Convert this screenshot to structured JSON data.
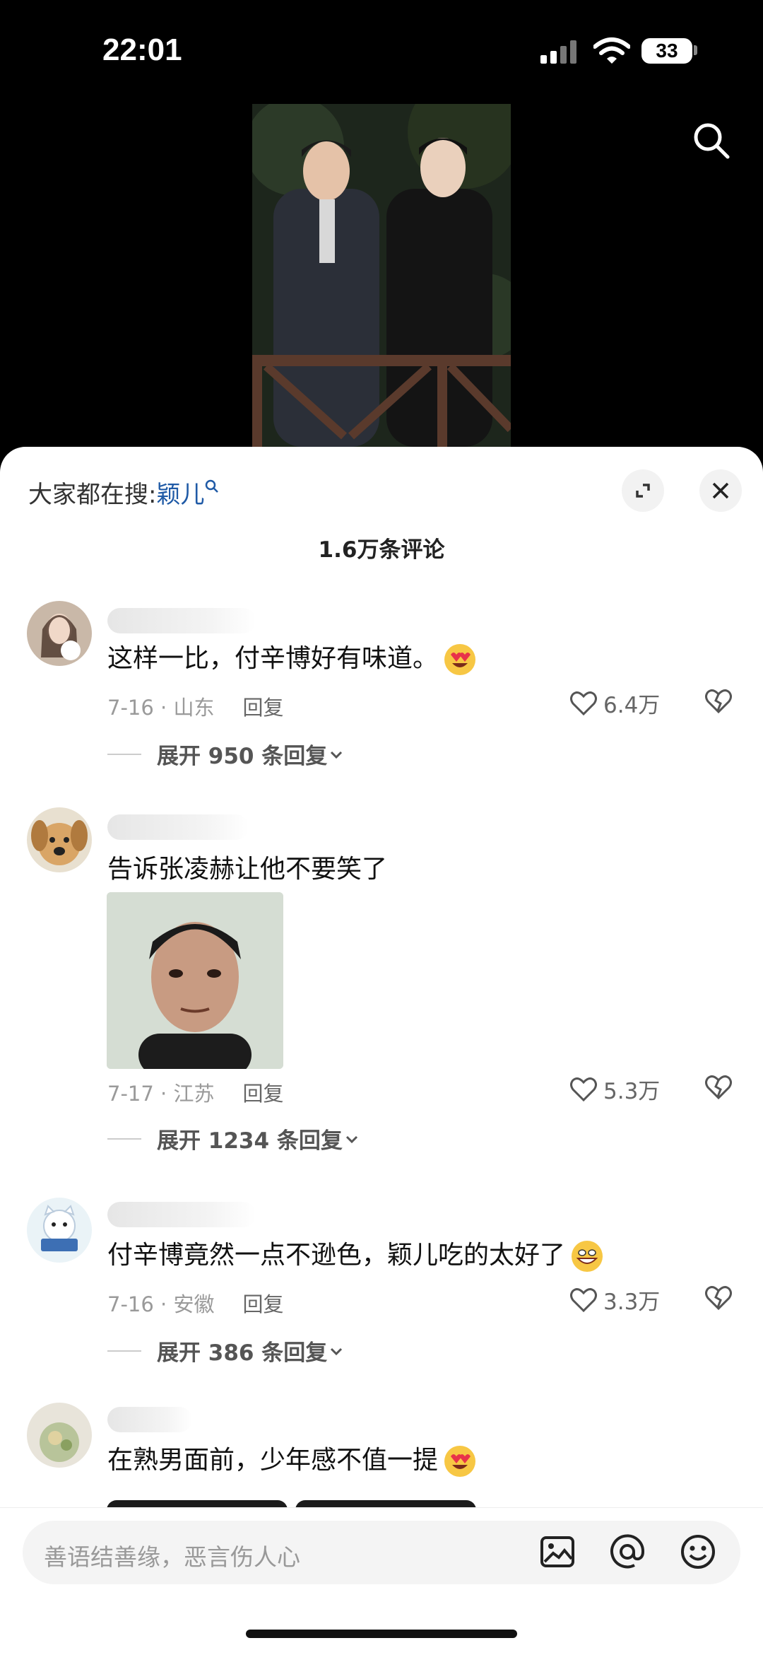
{
  "status_bar": {
    "time": "22:01",
    "battery": "33"
  },
  "sheet": {
    "hot_prefix": "大家都在搜:",
    "hot_keyword": "颖儿",
    "comment_count": "1.6万条评论"
  },
  "comments": [
    {
      "text": "这样一比，付辛博好有味道。",
      "date_loc": "7-16 · 山东",
      "reply_label": "回复",
      "likes": "6.4万",
      "expand": "展开 950 条回复"
    },
    {
      "text": "告诉张凌赫让他不要笑了",
      "date_loc": "7-17 · 江苏",
      "reply_label": "回复",
      "likes": "5.3万",
      "expand": "展开 1234 条回复"
    },
    {
      "text": "付辛博竟然一点不逊色，颖儿吃的太好了",
      "date_loc": "7-16 · 安徽",
      "reply_label": "回复",
      "likes": "3.3万",
      "expand": "展开 386 条回复"
    },
    {
      "text": "在熟男面前，少年感不值一提"
    }
  ],
  "input": {
    "placeholder": "善语结善缘，恶言伤人心"
  },
  "colors": {
    "link": "#1f5aa6",
    "sheet_bg": "#ffffff",
    "top_bg": "#000000"
  },
  "icons": [
    "search-icon",
    "expand-icon",
    "close-icon",
    "heart-icon",
    "broken-heart-icon",
    "chevron-down-icon",
    "image-icon",
    "at-icon",
    "smiley-icon"
  ]
}
